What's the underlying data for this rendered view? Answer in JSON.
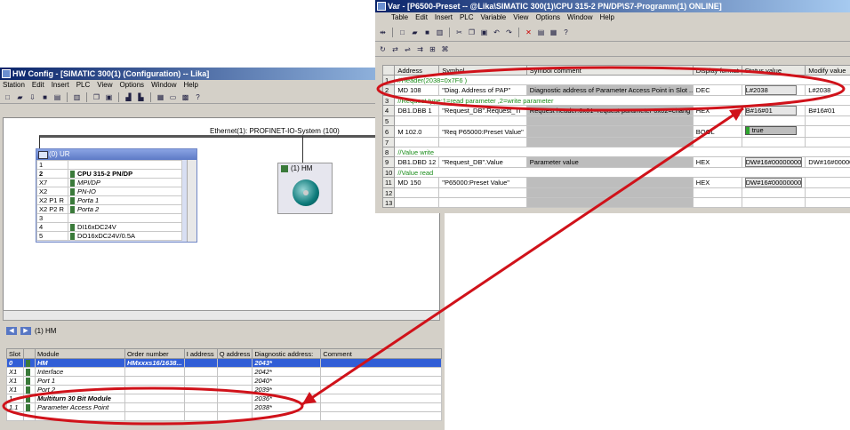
{
  "hw": {
    "title": "HW Config - [SIMATIC 300(1) (Configuration) -- Lika]",
    "menu": [
      "Station",
      "Edit",
      "Insert",
      "PLC",
      "View",
      "Options",
      "Window",
      "Help"
    ],
    "network_label": "Ethernet(1): PROFINET-IO-System (100)",
    "rack_title": "(0) UR",
    "rack_rows": [
      {
        "slot": "1",
        "module": ""
      },
      {
        "slot": "2",
        "module": "CPU 315-2 PN/DP"
      },
      {
        "slot": "X7",
        "module": "MPI/DP"
      },
      {
        "slot": "X2",
        "module": "PN-IO"
      },
      {
        "slot": "X2 P1 R",
        "module": "Porta 1"
      },
      {
        "slot": "X2 P2 R",
        "module": "Porta 2"
      },
      {
        "slot": "3",
        "module": ""
      },
      {
        "slot": "4",
        "module": "DI16xDC24V"
      },
      {
        "slot": "5",
        "module": "DO16xDC24V/0.5A"
      }
    ],
    "device_label": "(1) HM",
    "detail_title": "(1)  HM",
    "detail_headers": [
      "Slot",
      "",
      "Module",
      "Order number",
      "I address",
      "Q address",
      "Diagnostic address:",
      "Comment"
    ],
    "detail_rows": [
      {
        "slot": "0",
        "module": "HM",
        "order": "HMxxxs16/1638...",
        "i": "",
        "q": "",
        "diag": "2043*"
      },
      {
        "slot": "X1",
        "module": "Interface",
        "order": "",
        "i": "",
        "q": "",
        "diag": "2042*"
      },
      {
        "slot": "X1",
        "module": "Port 1",
        "order": "",
        "i": "",
        "q": "",
        "diag": "2040*"
      },
      {
        "slot": "X1",
        "module": "Port 2",
        "order": "",
        "i": "",
        "q": "",
        "diag": "2039*"
      },
      {
        "slot": "1",
        "module": "Multiturn 30 Bit Module",
        "order": "",
        "i": "",
        "q": "",
        "diag": "2036*"
      },
      {
        "slot": "1.1",
        "module": "Parameter Access Point",
        "order": "",
        "i": "",
        "q": "",
        "diag": "2038*"
      }
    ]
  },
  "var": {
    "title": "Var - [P6500-Preset -- @Lika\\SIMATIC 300(1)\\CPU 315-2 PN/DP\\S7-Programm(1)  ONLINE]",
    "menu": [
      "Table",
      "Edit",
      "Insert",
      "PLC",
      "Variable",
      "View",
      "Options",
      "Window",
      "Help"
    ],
    "headers": [
      "",
      "Address",
      "Symbol",
      "Symbol comment",
      "Display format",
      "Status value",
      "Modify value"
    ],
    "rows": [
      {
        "n": "1",
        "kind": "comment",
        "text": "//Header(2038=0x7F6 )"
      },
      {
        "n": "2",
        "kind": "data",
        "addr": "MD  108",
        "sym": "\"Diag. Address of PAP\"",
        "cmt": "Diagnostic address of Parameter Access Point in Slot ...",
        "fmt": "DEC",
        "status": "L#2038",
        "modify": "L#2038"
      },
      {
        "n": "3",
        "kind": "comment",
        "text": "//Request type:1=read parameter ,2=write parameter"
      },
      {
        "n": "4",
        "kind": "data",
        "addr": "DB1.DBB  1",
        "sym": "\"Request_DB\".Request_Ti",
        "cmt": "Request header:0x01=request parameter 0x02=chang",
        "fmt": "HEX",
        "status": "B#16#01",
        "modify": "B#16#01"
      },
      {
        "n": "5",
        "kind": "blank"
      },
      {
        "n": "6",
        "kind": "data",
        "addr": "M   102.0",
        "sym": "\"Req P65000:Preset Value\"",
        "cmt": "",
        "fmt": "BOOL",
        "status": "true",
        "modify": ""
      },
      {
        "n": "7",
        "kind": "blank"
      },
      {
        "n": "8",
        "kind": "comment",
        "text": "//Value write"
      },
      {
        "n": "9",
        "kind": "data",
        "addr": "DB1.DBD  12",
        "sym": "\"Request_DB\".Value",
        "cmt": "Parameter value",
        "fmt": "HEX",
        "status": "DW#16#00000000",
        "modify": "DW#16#000000"
      },
      {
        "n": "10",
        "kind": "comment",
        "text": "//Value read"
      },
      {
        "n": "11",
        "kind": "data",
        "addr": "MD  150",
        "sym": "\"P65000:Preset Value\"",
        "cmt": "",
        "fmt": "HEX",
        "status": "DW#16#00000000",
        "modify": ""
      },
      {
        "n": "12",
        "kind": "blank"
      },
      {
        "n": "13",
        "kind": "blank"
      }
    ]
  },
  "colors": {
    "title_active": "#0a246a",
    "title_gradient_end": "#a6caf0",
    "annotation": "#d0121a",
    "comment_text": "#1a8c1a",
    "selection": "#315ed6"
  }
}
